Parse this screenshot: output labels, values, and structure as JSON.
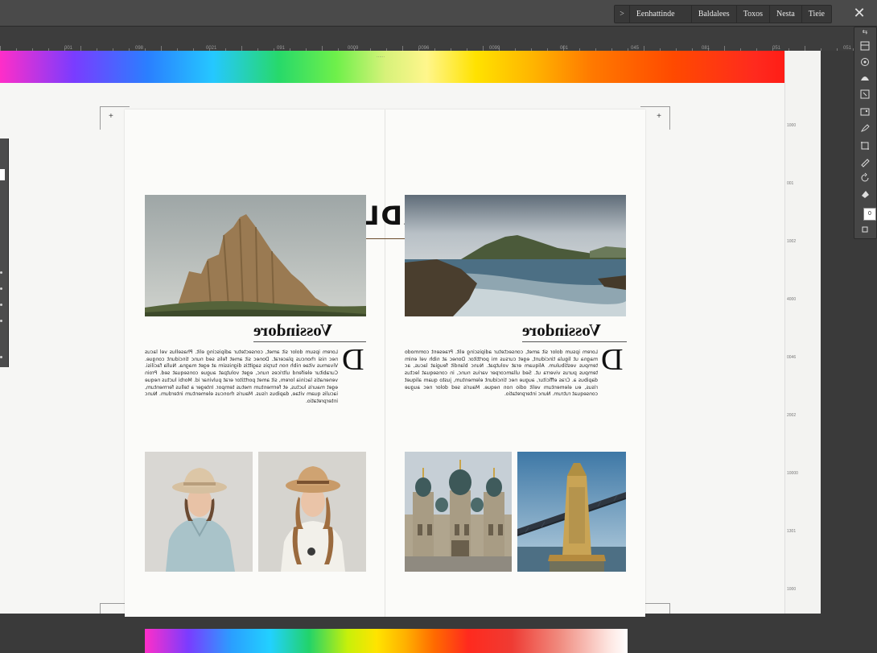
{
  "window": {
    "tabs": [
      ">",
      "Eenhattinde",
      "Baldalees",
      "Toxos",
      "Nesta",
      "Tieie"
    ],
    "close_icon": "close-icon"
  },
  "ruler": {
    "labels": [
      "001",
      "098",
      "0021",
      "091",
      "0009",
      "0096",
      "0099",
      "001",
      "045",
      "081",
      "051",
      "051"
    ]
  },
  "document": {
    "headline": "HEADLINE",
    "left_spread": {
      "subhead": "Vossindore",
      "dropcap": "D",
      "body": "Lorem ipsum dolor sit amet, consectetur adipiscing elit. Phasellus vel lacus nec nisi rhoncus placerat. Donec sit amet felis sed nunc tincidunt congue. Vivamus vitae nibh non turpis sagittis dignissim at eget magna. Nulla facilisi. Curabitur eleifend ultrices nunc, eget volutpat augue consequat sed. Proin venenatis lacinia lorem, sit amet porttitor erat pulvinar id. Morbi luctus neque eget mauris luctus, et fermentum metus tempor. Integer a tellus fermentum, iaculis quam vitae, dapibus risus. Mauris rhoncus elementum interdum. Nunc interpretatio."
    },
    "right_spread": {
      "subhead": "Vossindore",
      "dropcap": "D",
      "body": "Lorem ipsum dolor sit amet, consectetur adipiscing elit. Praesent commodo magna ut ligula tincidunt, eget cursus mi porttitor. Donec at nibh vel enim tempus vestibulum. Aliquam erat volutpat. Nunc blandit feugiat lacus, ac tempus purus viverra ut. Sed ullamcorper varius nunc, in consequat lectus dapibus a. Cras efficitur, augue nec tincidunt elementum, justo quam aliquet risus, eu elementum velit odio non neque. Mauris sed dolor nec augue consequat rutrum. Nunc interpretatio."
    }
  },
  "right_strip_numbers": [
    "1000",
    "001",
    "1002",
    "4000",
    "0046",
    "2002",
    "10000",
    "1301",
    "1000"
  ],
  "tools": [
    "layers-icon",
    "lasso-icon",
    "shape-icon",
    "polygon-icon",
    "frame-icon",
    "brush-icon",
    "crop-icon",
    "pen-icon",
    "rotate-icon",
    "fill-icon",
    "square-icon"
  ],
  "tool_badge": "0",
  "colors": {
    "chrome": "#4a4a4a",
    "canvas": "#f6f6f4",
    "page": "#fbfbf9"
  }
}
